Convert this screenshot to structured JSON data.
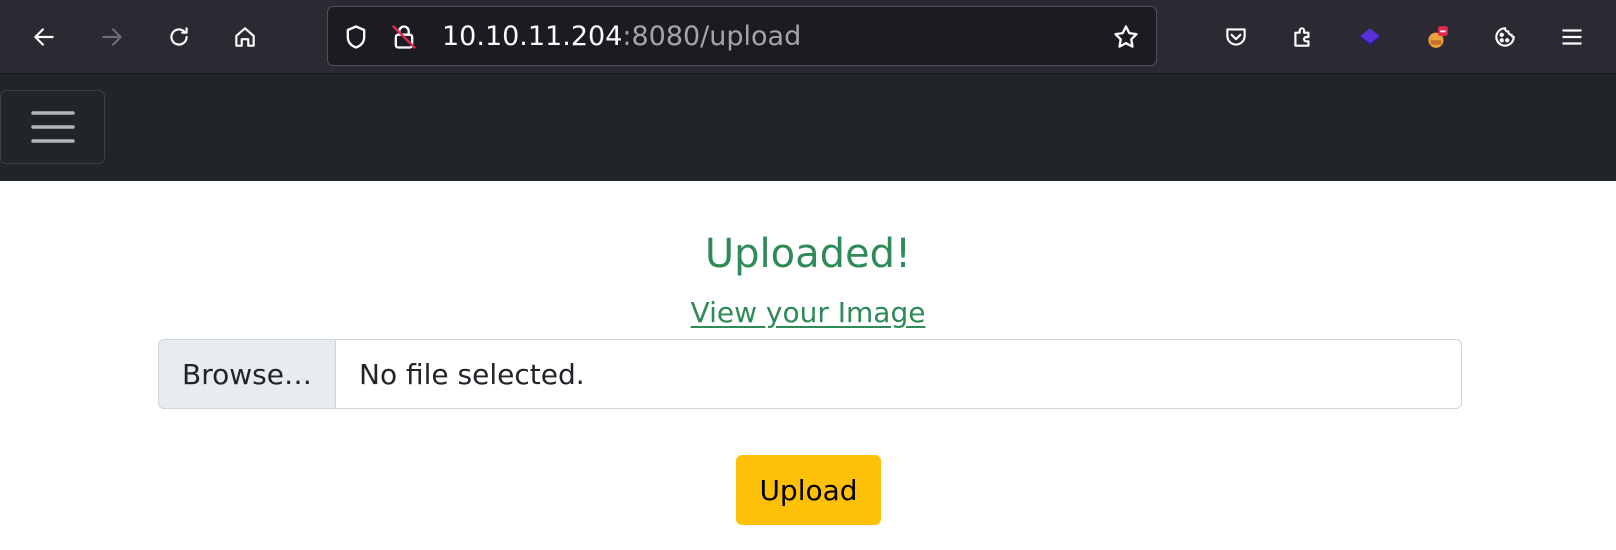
{
  "browser": {
    "url_host": "10.10.11.204",
    "url_path": ":8080/upload",
    "icons": {
      "back": "arrow-left-icon",
      "forward": "arrow-right-icon",
      "reload": "reload-icon",
      "home": "home-icon",
      "tracking": "shield-icon",
      "insecure": "insecure-lock-icon",
      "bookmark": "star-icon",
      "pocket": "pocket-icon",
      "extensions": "puzzle-icon",
      "ext1": "purple-diamond-icon",
      "ext2": "fox-extension-icon",
      "ext3": "cookie-icon",
      "menu": "hamburger-menu-icon"
    },
    "colors": {
      "toolbar": "#2b2a33",
      "urlbar": "#1c1b22"
    }
  },
  "navbar": {
    "toggler_icon": "hamburger-menu-icon",
    "background": "#212529"
  },
  "main": {
    "status_heading": "Uploaded!",
    "view_link": "View your Image",
    "file_input": {
      "button_label": "Browse…",
      "status": "No file selected."
    },
    "upload_button": "Upload",
    "colors": {
      "success": "#2e8b57",
      "warning": "#ffc107"
    }
  }
}
